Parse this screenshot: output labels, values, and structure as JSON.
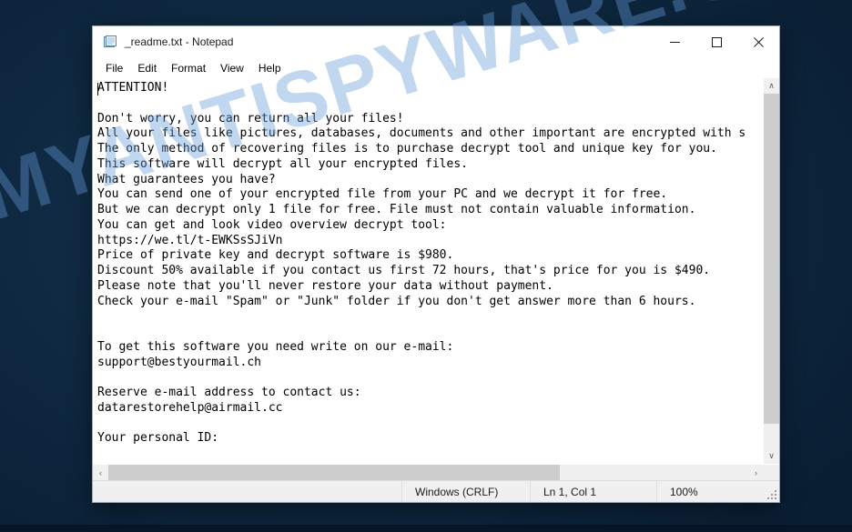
{
  "desktop": {
    "background_color": "#0d2740",
    "watermark_text": "MYANTISPYWARE.COM"
  },
  "window": {
    "title": "_readme.txt - Notepad",
    "icon": "notepad-icon",
    "controls": {
      "minimize_label": "—",
      "maximize_label": "☐",
      "close_label": "✕"
    }
  },
  "menu": {
    "items": [
      {
        "label": "File"
      },
      {
        "label": "Edit"
      },
      {
        "label": "Format"
      },
      {
        "label": "View"
      },
      {
        "label": "Help"
      }
    ]
  },
  "document": {
    "content": "ATTENTION!\n\nDon't worry, you can return all your files!\nAll your files like pictures, databases, documents and other important are encrypted with s\nThe only method of recovering files is to purchase decrypt tool and unique key for you.\nThis software will decrypt all your encrypted files.\nWhat guarantees you have?\nYou can send one of your encrypted file from your PC and we decrypt it for free.\nBut we can decrypt only 1 file for free. File must not contain valuable information.\nYou can get and look video overview decrypt tool:\nhttps://we.tl/t-EWKSsSJiVn\nPrice of private key and decrypt software is $980.\nDiscount 50% available if you contact us first 72 hours, that's price for you is $490.\nPlease note that you'll never restore your data without payment.\nCheck your e-mail \"Spam\" or \"Junk\" folder if you don't get answer more than 6 hours.\n\n\nTo get this software you need write on our e-mail:\nsupport@bestyourmail.ch\n\nReserve e-mail address to contact us:\ndatarestorehelp@airmail.cc\n\nYour personal ID:"
  },
  "scrollbars": {
    "vertical": {
      "up_arrow": "∧",
      "down_arrow": "∨"
    },
    "horizontal": {
      "left_arrow": "‹",
      "right_arrow": "›"
    }
  },
  "statusbar": {
    "encoding": "Windows (CRLF)",
    "position": "Ln 1, Col 1",
    "zoom": "100%"
  }
}
